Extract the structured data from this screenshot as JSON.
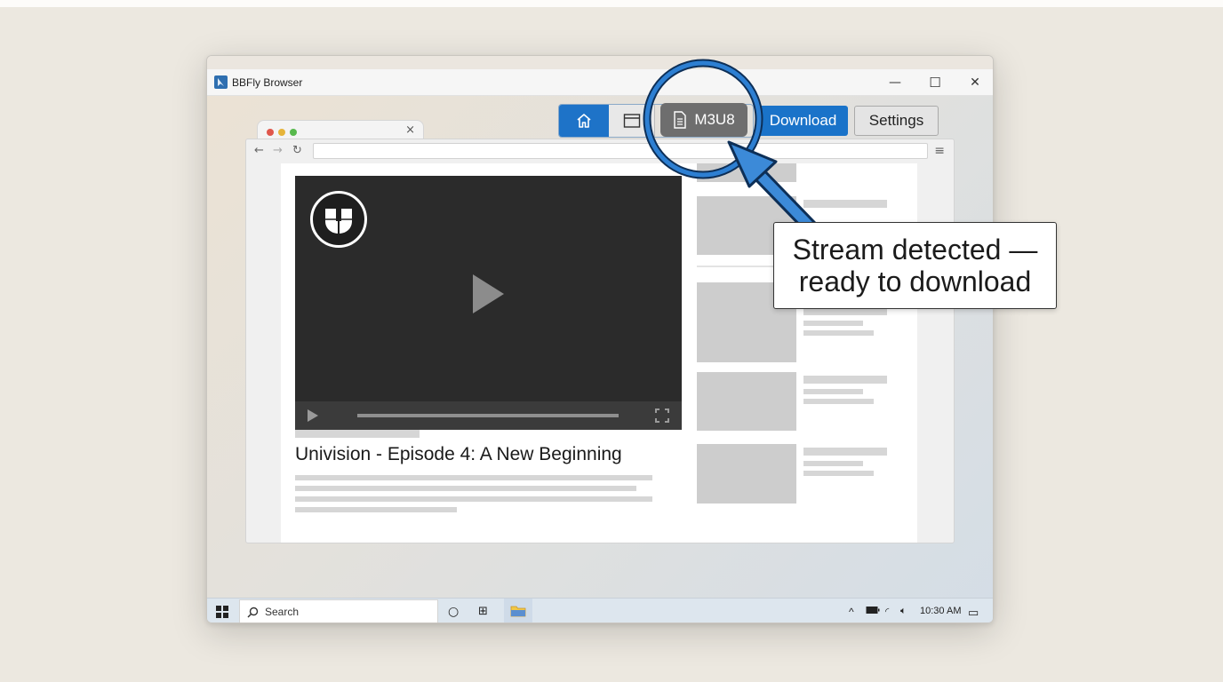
{
  "app": {
    "title": "BBFly Browser"
  },
  "window_controls": {
    "minimize": "—",
    "maximize": "☐",
    "close": "✕"
  },
  "toolbar": {
    "home_icon": "home-icon",
    "window_icon": "browser-window-icon",
    "m3u8_label": "M3U8",
    "m3u8_icon": "document-icon",
    "download_label": "Download",
    "settings_label": "Settings"
  },
  "callout": {
    "text": "Stream detected —\nready to download"
  },
  "page": {
    "video_title": "Univision - Episode 4: A New Beginning",
    "channel_logo": "univision-logo"
  },
  "taskbar": {
    "search_label": "Search",
    "clock": "10:30 AM"
  },
  "colors": {
    "accent": "#1a73c9",
    "highlight_ring": "#1f6fc0",
    "m3u8_button": "#6e6e6e"
  }
}
